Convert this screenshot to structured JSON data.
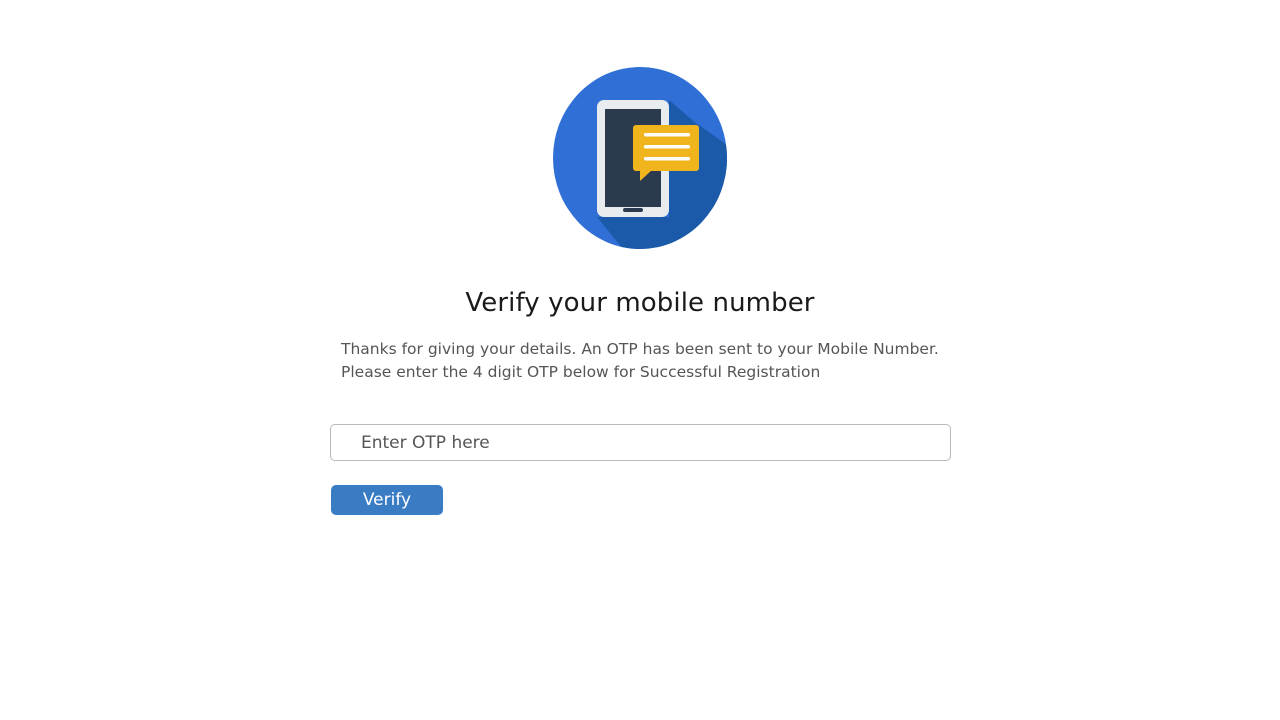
{
  "heading": {
    "title": "Verify your mobile number",
    "description_line1": "Thanks for giving your details. An OTP has been sent to your Mobile Number.",
    "description_line2": "Please enter the 4 digit OTP below for Successful Registration"
  },
  "otp_field": {
    "value": "",
    "placeholder": "Enter OTP here"
  },
  "verify_button": {
    "label": "Verify"
  },
  "illustration": {
    "icon": "phone-message-icon",
    "colors": {
      "circle": "#2f6fd6",
      "shadow": "#1a5aa8",
      "phone_body": "#e8ecef",
      "phone_screen": "#2b3a4f",
      "bubble": "#f0b51d"
    }
  }
}
